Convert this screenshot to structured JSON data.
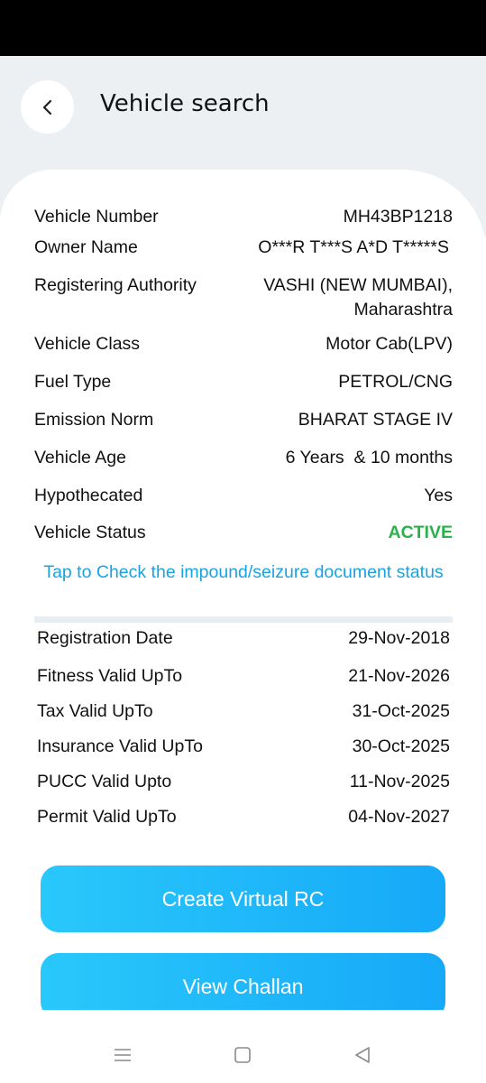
{
  "header": {
    "title": "Vehicle search"
  },
  "details": [
    {
      "label": "Vehicle Number",
      "value": "MH43BP1218"
    },
    {
      "label": "Owner Name",
      "value": "O***R T***S A*D T*****S"
    },
    {
      "label": "Registering Authority",
      "value": "VASHI (NEW MUMBAI), Maharashtra"
    },
    {
      "label": "Vehicle Class",
      "value": "Motor Cab(LPV)"
    },
    {
      "label": "Fuel Type",
      "value": "PETROL/CNG"
    },
    {
      "label": "Emission Norm",
      "value": "BHARAT STAGE IV"
    },
    {
      "label": "Vehicle Age",
      "value": "6 Years  & 10 months"
    },
    {
      "label": "Hypothecated",
      "value": "Yes"
    },
    {
      "label": "Vehicle Status",
      "value": "ACTIVE"
    }
  ],
  "status_color": "#2ab24a",
  "impound_link": "Tap to Check the impound/seizure document status",
  "validity": [
    {
      "label": "Registration Date",
      "value": "29-Nov-2018"
    },
    {
      "label": "Fitness Valid UpTo",
      "value": "21-Nov-2026"
    },
    {
      "label": "Tax Valid UpTo",
      "value": "31-Oct-2025"
    },
    {
      "label": "Insurance Valid UpTo",
      "value": "30-Oct-2025"
    },
    {
      "label": "PUCC Valid Upto",
      "value": "11-Nov-2025"
    },
    {
      "label": "Permit Valid UpTo",
      "value": "04-Nov-2027"
    }
  ],
  "buttons": {
    "virtual_rc": "Create Virtual RC",
    "view_challan": "View Challan"
  },
  "accent_color": "#1aa3e0",
  "icons": {
    "back": "chevron-left-icon",
    "nav_recents": "menu-icon",
    "nav_home": "square-icon",
    "nav_back": "triangle-back-icon"
  }
}
